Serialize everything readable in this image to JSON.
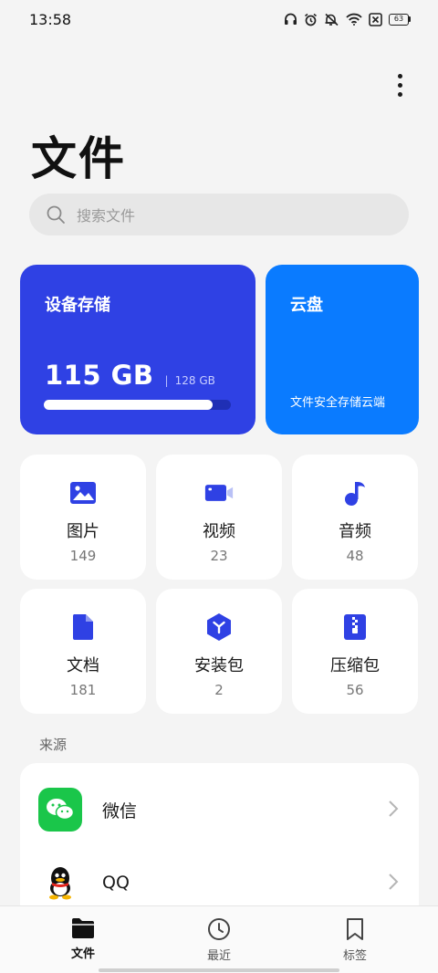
{
  "status_bar": {
    "time": "13:58",
    "battery": "63",
    "icons": [
      "headphones-icon",
      "alarm-icon",
      "mute-icon",
      "wifi-icon",
      "no-sim-icon",
      "battery-icon"
    ]
  },
  "header": {
    "title": "文件",
    "more_icon": "more-vertical-icon"
  },
  "search": {
    "placeholder": "搜索文件"
  },
  "storage": {
    "title": "设备存储",
    "used": "115 GB",
    "separator": "|",
    "total": "128 GB",
    "used_fraction": 0.9,
    "color": "#2f41e4"
  },
  "cloud": {
    "title": "云盘",
    "subtitle": "文件安全存储云端",
    "color": "#0a7bff"
  },
  "categories": [
    {
      "label": "图片",
      "count": "149",
      "icon": "image-icon"
    },
    {
      "label": "视频",
      "count": "23",
      "icon": "video-icon"
    },
    {
      "label": "音频",
      "count": "48",
      "icon": "music-note-icon"
    },
    {
      "label": "文档",
      "count": "181",
      "icon": "document-icon"
    },
    {
      "label": "安装包",
      "count": "2",
      "icon": "package-icon"
    },
    {
      "label": "压缩包",
      "count": "56",
      "icon": "zip-icon"
    }
  ],
  "sources": {
    "label": "来源",
    "items": [
      {
        "name": "微信",
        "icon": "wechat-icon",
        "color": "#1ac64a"
      },
      {
        "name": "QQ",
        "icon": "qq-icon"
      }
    ]
  },
  "bottom_nav": [
    {
      "label": "文件",
      "icon": "folder-icon",
      "active": true
    },
    {
      "label": "最近",
      "icon": "clock-icon",
      "active": false
    },
    {
      "label": "标签",
      "icon": "bookmark-icon",
      "active": false
    }
  ],
  "accent_color": "#2f41e4"
}
